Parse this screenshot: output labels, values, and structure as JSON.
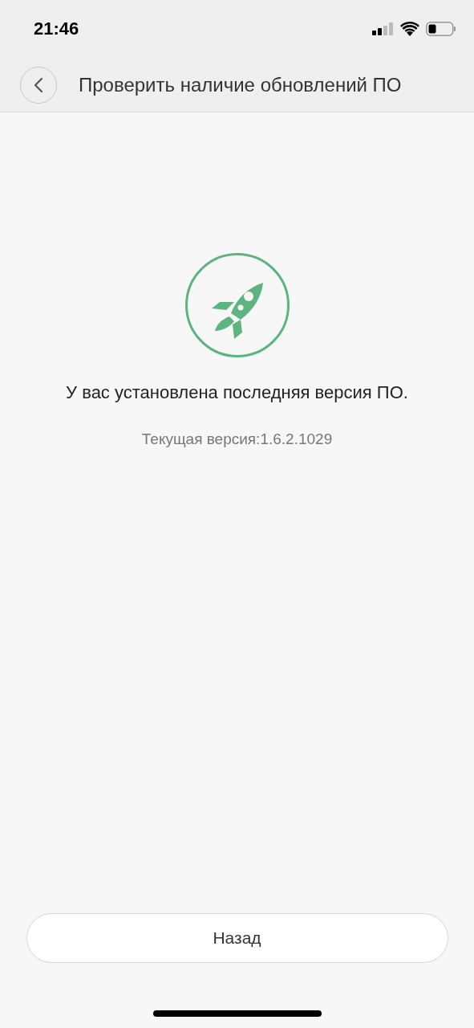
{
  "status_bar": {
    "time": "21:46"
  },
  "header": {
    "title": "Проверить наличие обновлений ПО"
  },
  "message": "У вас установлена последняя версия ПО.",
  "version": "Текущая версия:1.6.2.1029",
  "button": "Назад"
}
